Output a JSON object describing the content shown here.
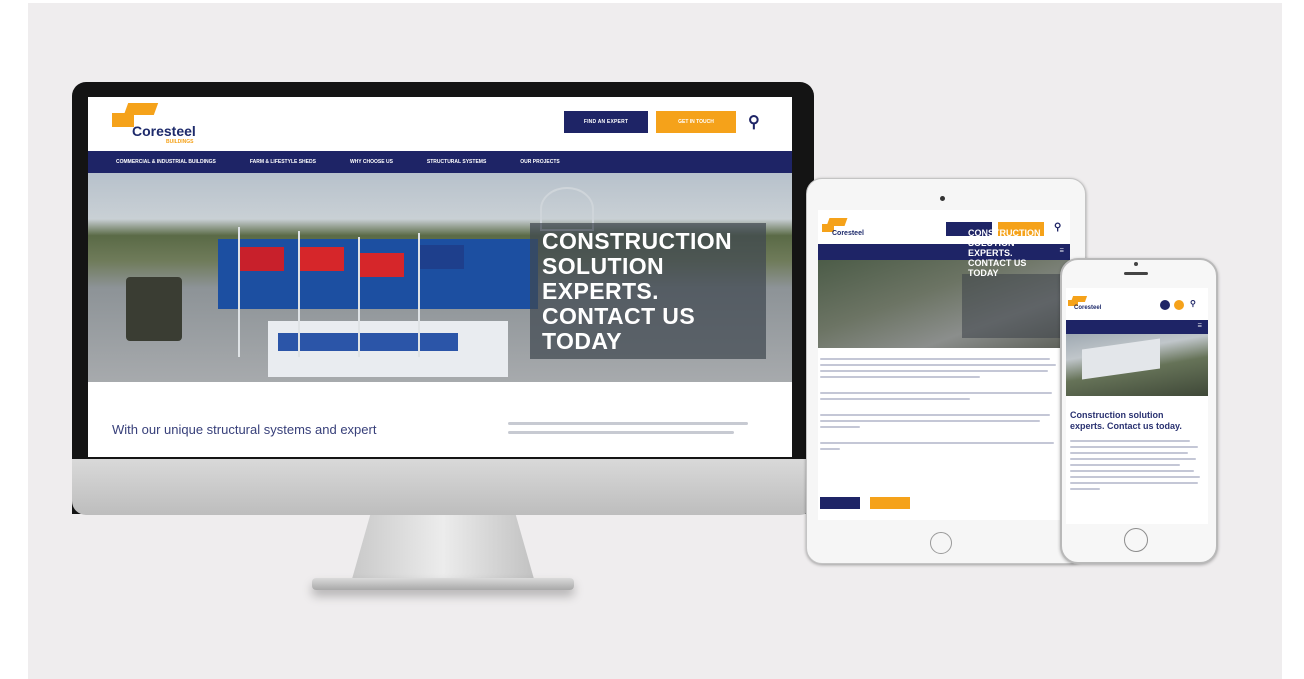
{
  "desktop": {
    "logo_text": "Coresteel",
    "logo_sub": "BUILDINGS",
    "find_expert_label": "FIND AN EXPERT",
    "get_in_touch_label": "GET IN TOUCH",
    "nav_items": [
      "COMMERCIAL & INDUSTRIAL BUILDINGS",
      "FARM & LIFESTYLE SHEDS",
      "WHY CHOOSE US",
      "STRUCTURAL SYSTEMS",
      "OUR PROJECTS"
    ],
    "hero_title_lines": [
      "CONSTRUCTION",
      "SOLUTION",
      "EXPERTS.",
      "CONTACT US",
      "TODAY"
    ],
    "intro_text": "With our unique structural systems and expert"
  },
  "tablet": {
    "logo_text": "Coresteel",
    "hero_title_lines": [
      "CONSTRUCTION",
      "SOLUTION",
      "EXPERTS.",
      "CONTACT US",
      "TODAY"
    ]
  },
  "phone": {
    "logo_text": "Coresteel",
    "title_lines": [
      "Construction solution",
      "experts. Contact us today."
    ]
  },
  "colors": {
    "navy": "#1e2466",
    "orange": "#f5a21a",
    "background": "#efedee"
  },
  "icons": [
    "search-icon",
    "menu-icon",
    "home-button-icon"
  ]
}
